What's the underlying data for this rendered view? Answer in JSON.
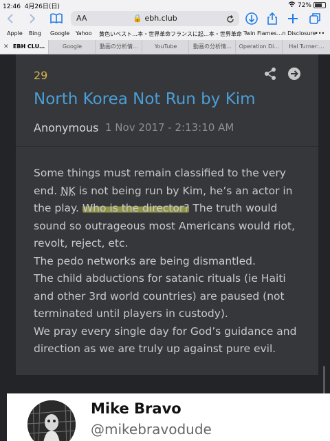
{
  "status": {
    "time": "12:46",
    "date": "4月26日(日)",
    "battery": "72%"
  },
  "toolbar": {
    "aa": "AA",
    "url": "ebh.club"
  },
  "bookmarks": [
    "Apple",
    "Bing",
    "Google",
    "Yahoo",
    "黄色いベスト…本・世界革命",
    "フランスに起…本・世界革命",
    "Twin Flames…n Disclosure",
    "•••"
  ],
  "tabs": [
    "EBH CLU…",
    "Google",
    "動画の分析情…",
    "YouTube",
    "動画の分析情…",
    "Operation Di…",
    "Hal Turner:…"
  ],
  "post": {
    "number": "29",
    "title": "North Korea Not Run by Kim",
    "author": "Anonymous",
    "date": "1 Nov 2017 - 2:13:10 AM",
    "body": {
      "p1_a": "Some things must remain classified to the very end. ",
      "p1_nk": "NK",
      "p1_b": " is not being run by Kim, he’s an actor in the play. ",
      "p1_hl": "Who is the director?",
      "p1_c": " The truth would sound so outrageous most Americans would riot, revolt, reject, etc.",
      "p2": "The pedo networks are being dismantled.",
      "p3": "The child abductions for satanic rituals (ie Haiti and other 3rd world countries) are paused (not terminated until players in custody).",
      "p4": "We pray every single day for God’s guidance and direction as we are truly up against pure evil."
    }
  },
  "tweet": {
    "name": "Mike Bravo",
    "handle": "@mikebravodude"
  },
  "colors": {
    "accent": "#1f7ae8",
    "title": "#4a9fd8",
    "number": "#d6b54a",
    "highlight": "#dae150"
  }
}
